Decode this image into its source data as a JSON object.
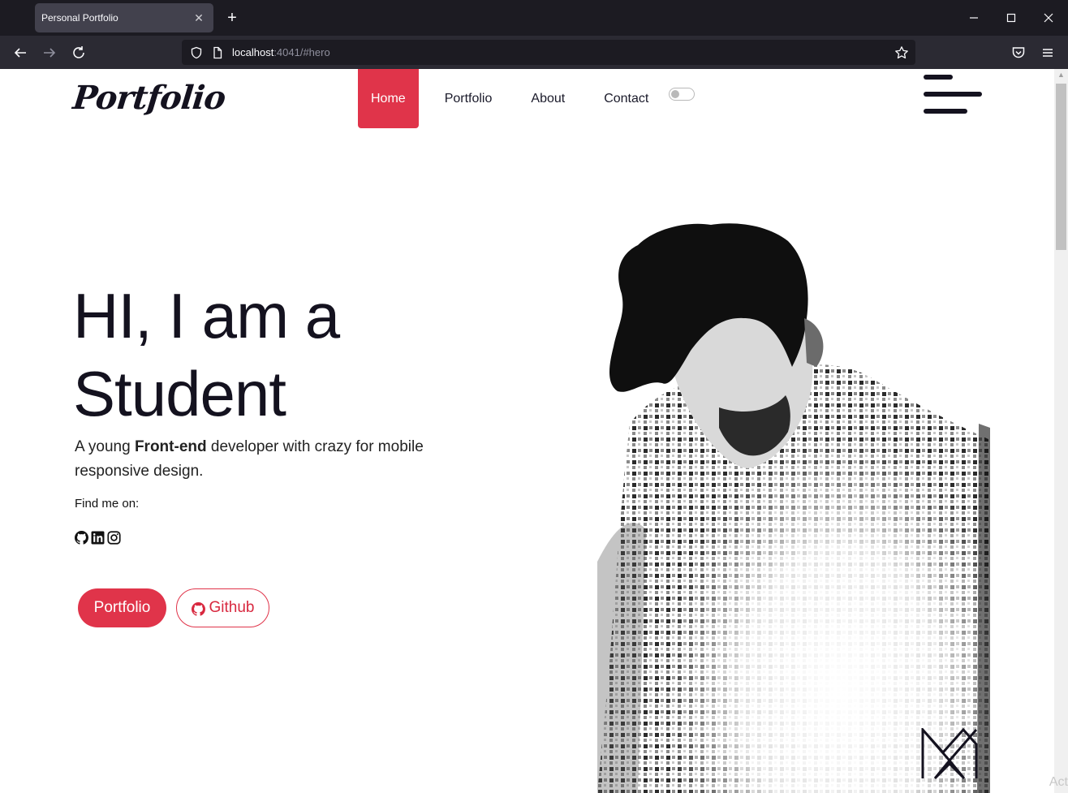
{
  "browser": {
    "tab_title": "Personal Portfolio",
    "url_host": "localhost",
    "url_rest": ":4041/#hero",
    "icons": [
      "close-icon",
      "plus-icon",
      "minimize-icon",
      "maximize-icon",
      "window-close-icon",
      "back-icon",
      "forward-icon",
      "reload-icon",
      "shield-icon",
      "page-icon",
      "star-icon",
      "pocket-icon",
      "menu-icon"
    ]
  },
  "site": {
    "logo": "Portfolio",
    "nav": [
      "Home",
      "Portfolio",
      "About",
      "Contact"
    ],
    "active_nav": "Home",
    "accent_color": "#e0344a"
  },
  "hero": {
    "title_line1": "HI, I am a",
    "title_line2": "Student",
    "sub_pre": "A young ",
    "sub_bold": "Front-end",
    "sub_post": " developer with crazy for mobile responsive design.",
    "find_label": "Find me on:",
    "social_icons": [
      "github-icon",
      "linkedin-icon",
      "instagram-icon"
    ],
    "btn_primary": "Portfolio",
    "btn_secondary": "Github"
  },
  "overlay": {
    "activate_text": "Act"
  }
}
